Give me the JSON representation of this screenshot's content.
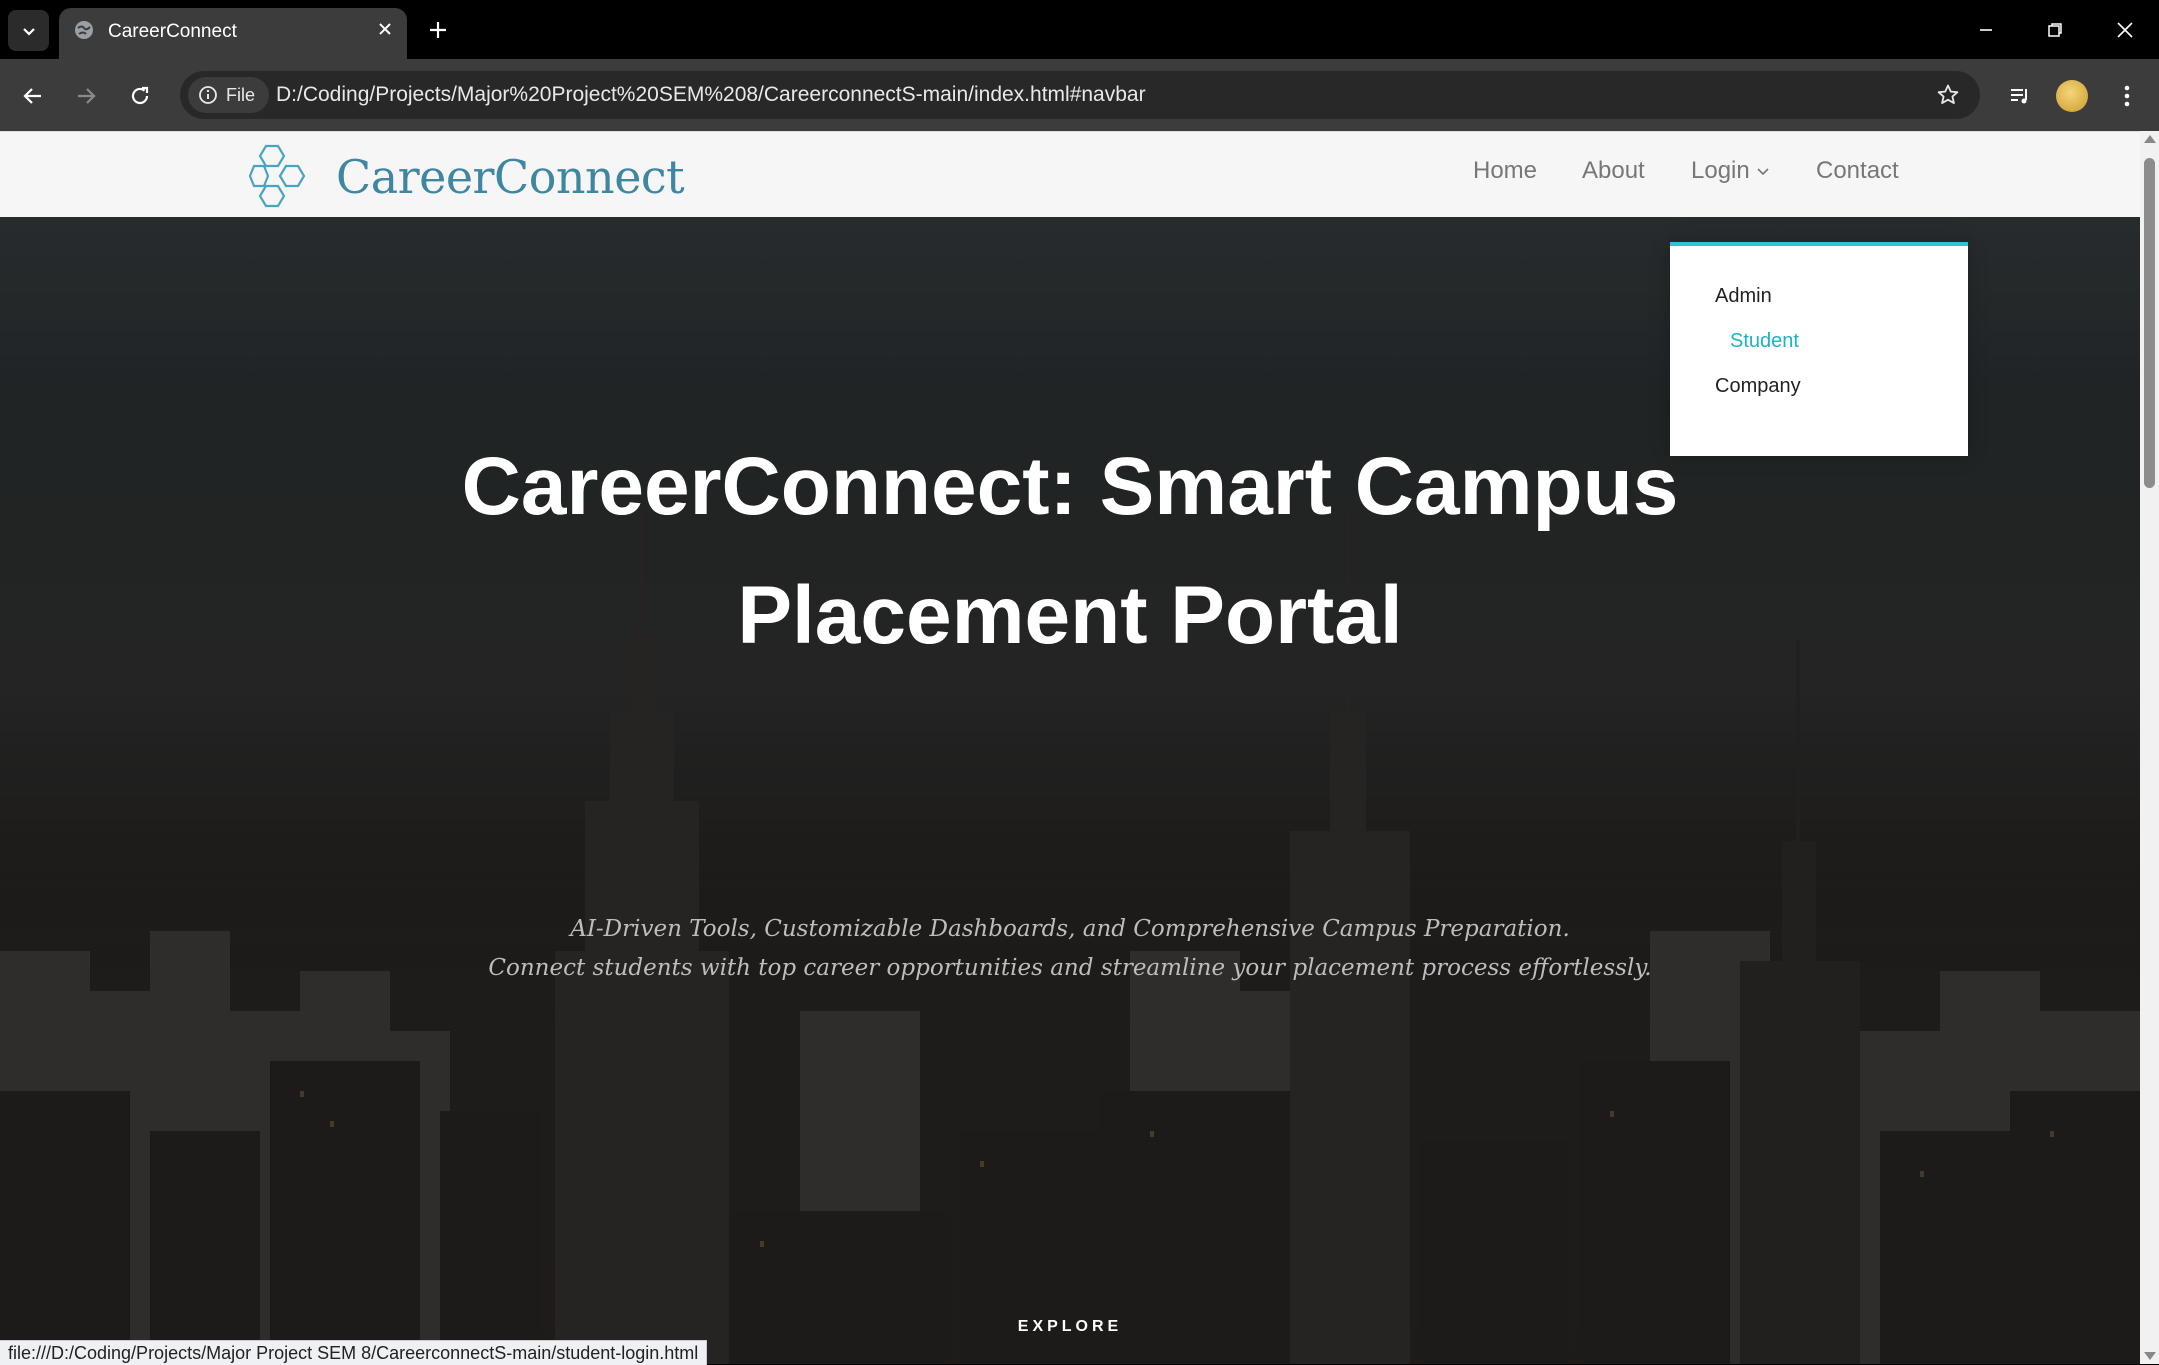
{
  "browser": {
    "tab_title": "CareerConnect",
    "url_chip": "File",
    "url": "D:/Coding/Projects/Major%20Project%20SEM%208/CareerconnectS-main/index.html#navbar",
    "status_url": "file:///D:/Coding/Projects/Major Project SEM 8/CareerconnectS-main/student-login.html"
  },
  "site": {
    "brand": "CareerConnect",
    "brand_color": "#3f86a3",
    "accent_color": "#2ec4d6",
    "nav": {
      "home": "Home",
      "about": "About",
      "login": "Login",
      "contact": "Contact"
    },
    "login_menu": {
      "admin": "Admin",
      "student": "Student",
      "company": "Company"
    }
  },
  "hero": {
    "title_line1": "CareerConnect: Smart Campus",
    "title_line2": "Placement Portal",
    "subtitle_line1": "AI-Driven Tools, Customizable Dashboards, and Comprehensive Campus Preparation.",
    "subtitle_line2": "Connect students with top career opportunities and streamline your placement process effortlessly.",
    "explore": "EXPLORE"
  }
}
